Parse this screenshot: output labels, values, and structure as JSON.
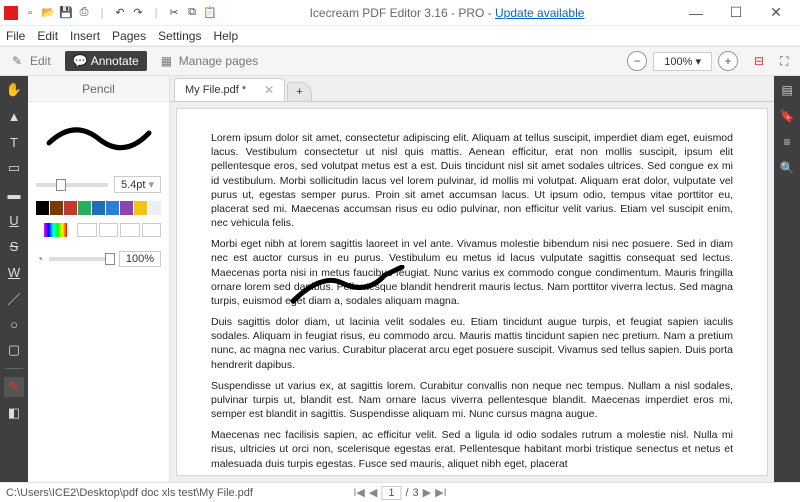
{
  "titlebar": {
    "app_name": "Icecream PDF Editor 3.16",
    "edition": "PRO",
    "update_link": "Update available"
  },
  "menubar": [
    "File",
    "Edit",
    "Insert",
    "Pages",
    "Settings",
    "Help"
  ],
  "toolbar": {
    "edit": "Edit",
    "annotate": "Annotate",
    "manage": "Manage pages",
    "zoom": "100%"
  },
  "pencil_panel": {
    "title": "Pencil",
    "stroke": "5.4pt",
    "opacity": "100%",
    "colors": [
      "#000000",
      "#7a3b00",
      "#c0392b",
      "#27ae60",
      "#1e6fb8",
      "#2980d9",
      "#8e44ad",
      "#f1c40f",
      "#ecf0f1"
    ]
  },
  "tabs": {
    "file_label": "My File.pdf *",
    "add": "+"
  },
  "document": {
    "p1": "Lorem ipsum dolor sit amet, consectetur adipiscing elit. Aliquam at tellus suscipit, imperdiet diam eget, euismod lacus. Vestibulum consectetur ut nisl quis mattis. Aenean efficitur, erat non mollis suscipit, ipsum elit pellentesque eros, sed volutpat metus est a est. Duis tincidunt nisl sit amet sodales ultrices. Sed congue ex mi id vestibulum. Morbi sollicitudin lacus vel lorem pulvinar, id mollis mi volutpat. Aliquam erat dolor, vulputate vel purus ut, egestas semper purus. Proin sit amet accumsan lacus. Ut ipsum odio, tempus vitae porttitor eu, placerat sed mi. Maecenas accumsan risus eu odio pulvinar, non efficitur velit varius. Etiam vel suscipit enim, nec vehicula felis.",
    "p2": "Morbi eget nibh at lorem sagittis laoreet in vel ante. Vivamus molestie bibendum nisi nec posuere. Sed in diam nec est auctor cursus in eu purus. Vestibulum eu metus id lacus vulputate sagittis consequat sed lectus. Maecenas porta nisi in metus faucibus feugiat. Nunc varius ex commodo congue condimentum. Mauris fringilla ornare lorem sed dapibus. Pellentesque blandit hendrerit mauris lectus. Nam porttitor viverra lectus. Sed magna turpis, euismod eget diam a, sodales aliquam magna.",
    "p3": "Duis sagittis dolor diam, ut lacinia velit sodales eu. Etiam tincidunt augue turpis, et feugiat sapien iaculis sodales. Aliquam in feugiat risus, eu commodo arcu. Mauris mattis tincidunt sapien nec pretium. Nam a pretium nunc, ac magna nec varius. Curabitur placerat arcu eget posuere suscipit. Vivamus sed tellus sapien. Duis porta hendrerit dapibus.",
    "p4": "Suspendisse ut varius ex, at sagittis lorem. Curabitur convallis non neque nec tempus. Nullam a nisl sodales, pulvinar turpis ut, blandit est. Nam ornare lacus viverra pellentesque blandit. Maecenas imperdiet eros mi, semper est blandit in sagittis. Suspendisse aliquam mi. Nunc cursus magna augue.",
    "p5": "Maecenas nec facilisis sapien, ac efficitur velit. Sed a ligula id odio sodales rutrum a molestie nisl. Nulla mi risus, ultricies ut orci non, scelerisque egestas erat. Pellentesque habitant morbi tristique senectus et netus et malesuada duis turpis egestas. Fusce sed mauris, aliquet nibh eget, placerat"
  },
  "status": {
    "path": "C:\\Users\\ICE2\\Desktop\\pdf doc xls test\\My File.pdf",
    "page_current": "1",
    "page_total": "3"
  }
}
